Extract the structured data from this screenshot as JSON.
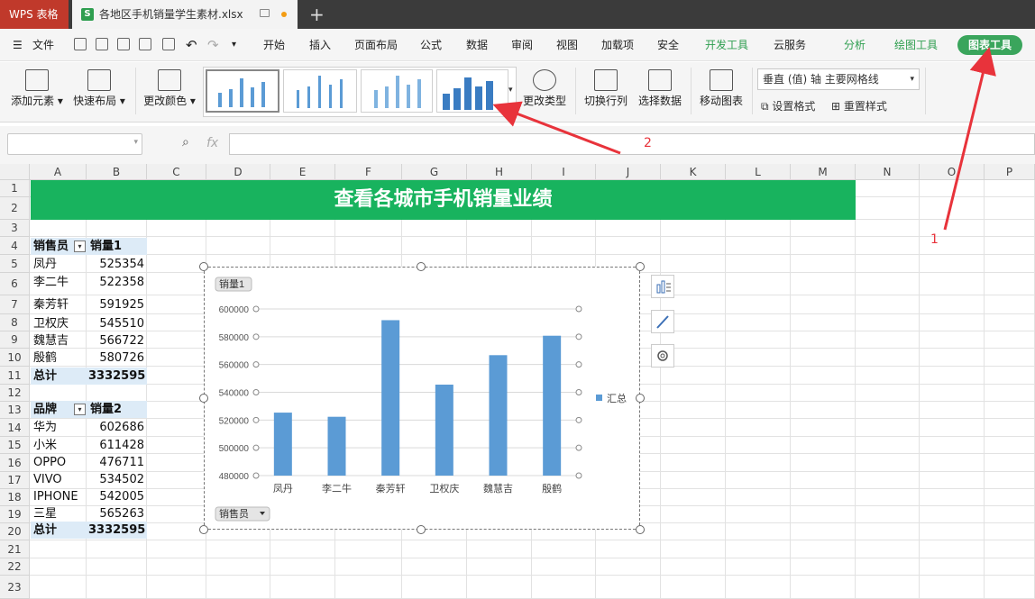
{
  "titlebar": {
    "app": "WPS 表格",
    "file": "各地区手机销量学生素材.xlsx"
  },
  "menubar": {
    "file": "文件",
    "tabs": [
      "开始",
      "插入",
      "页面布局",
      "公式",
      "数据",
      "审阅",
      "视图",
      "加载项",
      "安全",
      "开发工具",
      "云服务"
    ],
    "analyze": "分析",
    "draw_tools": "绘图工具",
    "chart_tools": "图表工具"
  },
  "ribbon": {
    "add_element": "添加元素",
    "quick_layout": "快速布局",
    "change_color": "更改颜色",
    "change_type": "更改类型",
    "switch_rowcol": "切换行列",
    "select_data": "选择数据",
    "move_chart": "移动图表",
    "axis_select": "垂直 (值) 轴 主要网格线",
    "set_format": "设置格式",
    "reset_style": "重置样式"
  },
  "formula": {
    "fx": "fx"
  },
  "columns": [
    "A",
    "B",
    "C",
    "D",
    "E",
    "F",
    "G",
    "H",
    "I",
    "J",
    "K",
    "L",
    "M",
    "N",
    "O",
    "P"
  ],
  "rows": [
    "1",
    "2",
    "3",
    "4",
    "5",
    "6",
    "7",
    "8",
    "9",
    "10",
    "11",
    "12",
    "13",
    "14",
    "15",
    "16",
    "17",
    "18",
    "19",
    "20",
    "21",
    "22",
    "23"
  ],
  "banner": "查看各城市手机销量业绩",
  "table1": {
    "h1": "销售员",
    "h2": "销量1",
    "rows": [
      [
        "凤丹",
        "525354"
      ],
      [
        "李二牛",
        "522358"
      ],
      [
        "秦芳轩",
        "591925"
      ],
      [
        "卫权庆",
        "545510"
      ],
      [
        "魏慧吉",
        "566722"
      ],
      [
        "殷鹤",
        "580726"
      ]
    ],
    "total_label": "总计",
    "total": "3332595"
  },
  "table2": {
    "h1": "品牌",
    "h2": "销量2",
    "rows": [
      [
        "华为",
        "602686"
      ],
      [
        "小米",
        "611428"
      ],
      [
        "OPPO",
        "476711"
      ],
      [
        "VIVO",
        "534502"
      ],
      [
        "IPHONE",
        "542005"
      ],
      [
        "三星",
        "565263"
      ]
    ],
    "total_label": "总计",
    "total": "3332595"
  },
  "annotations": {
    "a1": "1",
    "a2": "2"
  },
  "chart_data": {
    "type": "bar",
    "title": "",
    "field_button": "销量1",
    "axis_button": "销售员",
    "categories": [
      "凤丹",
      "李二牛",
      "秦芳轩",
      "卫权庆",
      "魏慧吉",
      "殷鹤"
    ],
    "series": [
      {
        "name": "汇总",
        "values": [
          525354,
          522358,
          591925,
          545510,
          566722,
          580726
        ]
      }
    ],
    "ylim": [
      480000,
      600000
    ],
    "yticks": [
      "600000",
      "580000",
      "560000",
      "540000",
      "520000",
      "500000",
      "480000"
    ],
    "color": "#5b9bd5",
    "grid": true,
    "legend": "right"
  }
}
